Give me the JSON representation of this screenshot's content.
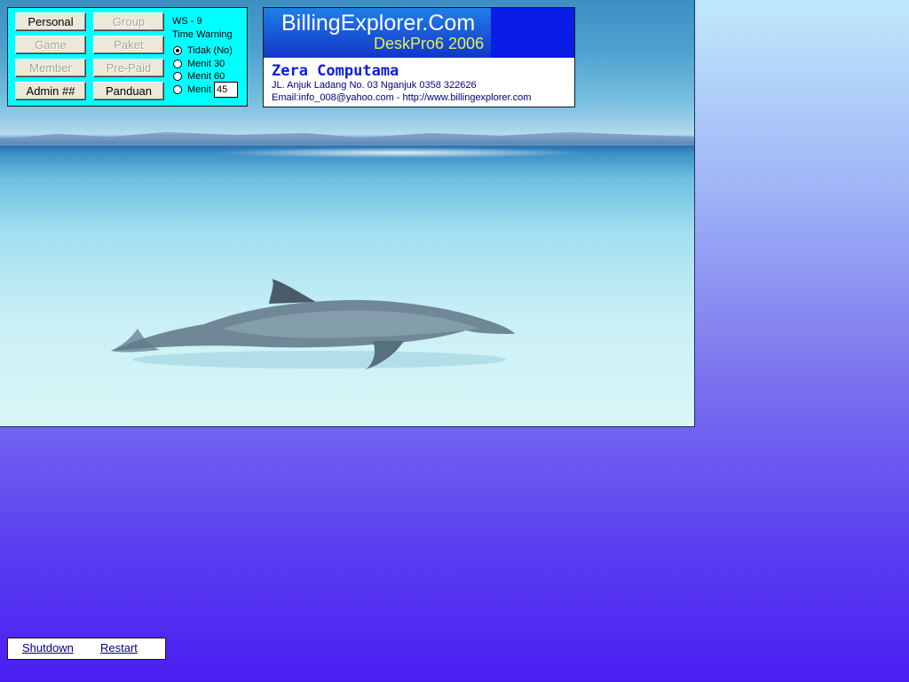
{
  "panel": {
    "buttons": {
      "personal": "Personal",
      "group": "Group",
      "game": "Game",
      "paket": "Paket",
      "member": "Member",
      "prepaid": "Pre-Paid",
      "admin": "Admin ##",
      "panduan": "Panduan"
    },
    "ws_label": "WS - 9",
    "time_warning_label": "Time Warning",
    "options": [
      {
        "label": "Tidak (No)",
        "checked": true
      },
      {
        "label": "Menit  30",
        "checked": false
      },
      {
        "label": "Menit  60",
        "checked": false
      },
      {
        "label": "Menit",
        "checked": false
      }
    ],
    "custom_minutes": "45"
  },
  "brand": {
    "title": "BillingExplorer.Com",
    "subtitle": "DeskPro6 2006",
    "company": "Zera Computama",
    "address": "JL. Anjuk Ladang No. 03 Nganjuk 0358 322626",
    "contact": "Email:info_008@yahoo.com - http://www.billingexplorer.com"
  },
  "bottom": {
    "shutdown": "Shutdown",
    "restart": "Restart"
  },
  "colors": {
    "panel_bg": "#00ffff",
    "brand_blue": "#0a1ce6",
    "brand_subtitle": "#e6f05a",
    "desktop_bottom": "#4a1ef2"
  }
}
